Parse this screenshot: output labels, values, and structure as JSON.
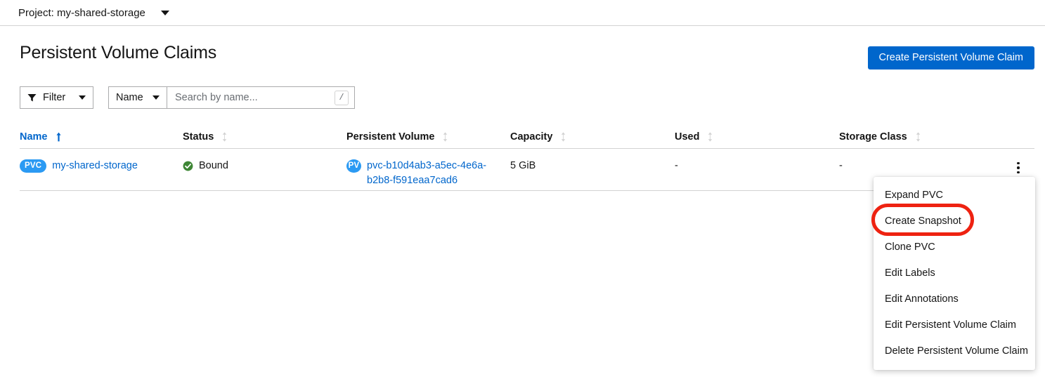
{
  "project_bar": {
    "label": "Project: my-shared-storage",
    "caret_icon": "chevron-down-icon"
  },
  "header": {
    "title": "Persistent Volume Claims",
    "create_button": "Create Persistent Volume Claim",
    "accent_color": "#0066cc"
  },
  "toolbar": {
    "filter_label": "Filter",
    "filter_icon": "funnel-icon",
    "attribute_label": "Name",
    "search_placeholder": "Search by name...",
    "search_value": "",
    "shortcut_key": "/"
  },
  "table": {
    "columns": [
      {
        "label": "Name",
        "sort": "asc",
        "active": true
      },
      {
        "label": "Status",
        "sort": "none",
        "active": false
      },
      {
        "label": "Persistent Volume",
        "sort": "none",
        "active": false
      },
      {
        "label": "Capacity",
        "sort": "none",
        "active": false
      },
      {
        "label": "Used",
        "sort": "none",
        "active": false
      },
      {
        "label": "Storage Class",
        "sort": "none",
        "active": false
      }
    ],
    "rows": [
      {
        "name_badge": "PVC",
        "name": "my-shared-storage",
        "status": "Bound",
        "status_icon": "check-circle-icon",
        "status_color": "#3e8635",
        "pv_badge": "PV",
        "pv_name": "pvc-b10d4ab3-a5ec-4e6a-b2b8-f591eaa7cad6",
        "capacity": "5 GiB",
        "used": "-",
        "storage_class": "-",
        "kebab_icon": "kebab-menu-icon"
      }
    ]
  },
  "dropdown": {
    "items": [
      {
        "label": "Expand PVC"
      },
      {
        "label": "Create Snapshot",
        "highlighted": true
      },
      {
        "label": "Clone PVC"
      },
      {
        "label": "Edit Labels"
      },
      {
        "label": "Edit Annotations"
      },
      {
        "label": "Edit Persistent Volume Claim"
      },
      {
        "label": "Delete Persistent Volume Claim"
      }
    ]
  },
  "annotation": {
    "target": "Create Snapshot",
    "shape": "ellipse",
    "color": "#ee2211"
  }
}
